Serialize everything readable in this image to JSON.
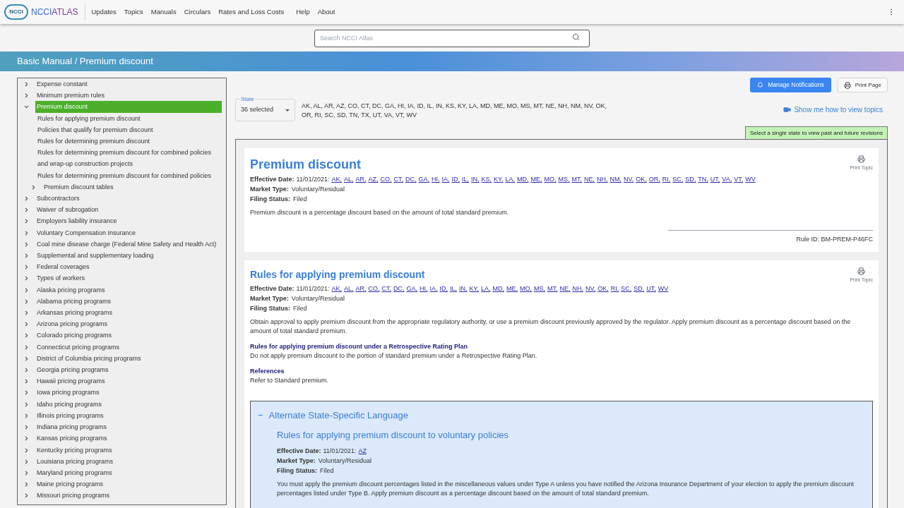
{
  "header": {
    "logo_badge": "NCCI",
    "logo_text_a": "NCCI",
    "logo_text_b": "ATLAS",
    "nav": [
      "Updates",
      "Topics",
      "Manuals",
      "Circulars",
      "Rates and Loss Costs",
      "Help",
      "About"
    ]
  },
  "search": {
    "placeholder": "Search NCCI Atlas"
  },
  "breadcrumb": "Basic Manual / Premium discount",
  "tree": [
    {
      "label": "Expense constant",
      "kind": "folder",
      "expanded": false,
      "selected": false
    },
    {
      "label": "Minimum premium rules",
      "kind": "folder",
      "expanded": false,
      "selected": false
    },
    {
      "label": "Premium discount",
      "kind": "folder",
      "expanded": true,
      "selected": true,
      "children": [
        {
          "label": "Rules for applying premium discount",
          "kind": "leaf",
          "selected": false
        },
        {
          "label": "Policies that qualify for premium discount",
          "kind": "leaf",
          "selected": false
        },
        {
          "label": "Rules for determining premium discount",
          "kind": "leaf",
          "selected": false
        },
        {
          "label": "Rules for determining premium discount for combined policies and wrap-up construction projects",
          "kind": "leaf",
          "selected": false
        },
        {
          "label": "Rules for determining premium discount for combined policies",
          "kind": "leaf",
          "selected": false
        },
        {
          "label": "Premium discount tables",
          "kind": "folder",
          "expanded": false,
          "selected": false
        }
      ]
    },
    {
      "label": "Subcontractors",
      "kind": "folder",
      "expanded": false,
      "selected": false
    },
    {
      "label": "Waiver of subrogation",
      "kind": "folder",
      "expanded": false,
      "selected": false
    },
    {
      "label": "Employers liability insurance",
      "kind": "folder",
      "expanded": false,
      "selected": false
    },
    {
      "label": "Voluntary Compensation Insurance",
      "kind": "folder",
      "expanded": false,
      "selected": false
    },
    {
      "label": "Coal mine disease charge (Federal Mine Safety and Health Act)",
      "kind": "folder",
      "expanded": false,
      "selected": false
    },
    {
      "label": "Supplemental and supplementary loading",
      "kind": "folder",
      "expanded": false,
      "selected": false
    },
    {
      "label": "Federal coverages",
      "kind": "folder",
      "expanded": false,
      "selected": false
    },
    {
      "label": "Types of workers",
      "kind": "folder",
      "expanded": false,
      "selected": false
    },
    {
      "label": "Alaska pricing programs",
      "kind": "folder",
      "expanded": false,
      "selected": false
    },
    {
      "label": "Alabama pricing programs",
      "kind": "folder",
      "expanded": false,
      "selected": false
    },
    {
      "label": "Arkansas pricing programs",
      "kind": "folder",
      "expanded": false,
      "selected": false
    },
    {
      "label": "Arizona pricing programs",
      "kind": "folder",
      "expanded": false,
      "selected": false
    },
    {
      "label": "Colorado pricing programs",
      "kind": "folder",
      "expanded": false,
      "selected": false
    },
    {
      "label": "Connecticut pricing programs",
      "kind": "folder",
      "expanded": false,
      "selected": false
    },
    {
      "label": "District of Columbia pricing programs",
      "kind": "folder",
      "expanded": false,
      "selected": false
    },
    {
      "label": "Georgia pricing programs",
      "kind": "folder",
      "expanded": false,
      "selected": false
    },
    {
      "label": "Hawaii pricing programs",
      "kind": "folder",
      "expanded": false,
      "selected": false
    },
    {
      "label": "Iowa pricing programs",
      "kind": "folder",
      "expanded": false,
      "selected": false
    },
    {
      "label": "Idaho pricing programs",
      "kind": "folder",
      "expanded": false,
      "selected": false
    },
    {
      "label": "Illinois pricing programs",
      "kind": "folder",
      "expanded": false,
      "selected": false
    },
    {
      "label": "Indiana pricing programs",
      "kind": "folder",
      "expanded": false,
      "selected": false
    },
    {
      "label": "Kansas pricing programs",
      "kind": "folder",
      "expanded": false,
      "selected": false
    },
    {
      "label": "Kentucky pricing programs",
      "kind": "folder",
      "expanded": false,
      "selected": false
    },
    {
      "label": "Louisiana pricing programs",
      "kind": "folder",
      "expanded": false,
      "selected": false
    },
    {
      "label": "Maryland pricing programs",
      "kind": "folder",
      "expanded": false,
      "selected": false
    },
    {
      "label": "Maine pricing programs",
      "kind": "folder",
      "expanded": false,
      "selected": false
    },
    {
      "label": "Missouri pricing programs",
      "kind": "folder",
      "expanded": false,
      "selected": false
    }
  ],
  "state_filter": {
    "label": "State",
    "value": "36 selected",
    "states_line_1": "AK, AL, AR, AZ, CO, CT, DC, GA, HI, IA, ID, IL, IN, KS, KY, LA, MD, ME, MO, MS, MT, NE, NH, NM, NV, OK,",
    "states_line_2": "OR, RI, SC, SD, TN, TX, UT, VA, VT, WV"
  },
  "actions": {
    "notify": "Manage Notifications",
    "print": "Print Page",
    "howto": "Show me how to view topics",
    "note": "Select a single state to view past and future revisions"
  },
  "topics": [
    {
      "title": "Premium discount",
      "print": "Print Topic",
      "effective_label": "Effective Date:",
      "effective_date": "11/01/2021:",
      "states": [
        "AK,",
        "AL,",
        "AR,",
        "AZ,",
        "CO,",
        "CT,",
        "DC,",
        "GA,",
        "HI,",
        "IA,",
        "ID,",
        "IL,",
        "IN,",
        "KS,",
        "KY,",
        "LA,",
        "MD,",
        "ME,",
        "MO,",
        "MS,",
        "MT,",
        "NE,",
        "NH,",
        "NM,",
        "NV,",
        "OK,",
        "OR,",
        "RI,",
        "SC,",
        "SD,",
        "TN,",
        "UT,",
        "VA,",
        "VT,",
        "WV"
      ],
      "market_label": "Market Type:",
      "market": "Voluntary/Residual",
      "filing_label": "Filing Status:",
      "filing": "Filed",
      "body": "Premium discount is a percentage discount based on the amount of total standard premium.",
      "rule_id": "Rule ID: BM-PREM-P46FC"
    },
    {
      "title": "Rules for applying premium discount",
      "print": "Print Topic",
      "effective_label": "Effective Date:",
      "effective_date": "11/01/2021:",
      "states": [
        "AK,",
        "AL,",
        "AR,",
        "CO,",
        "CT,",
        "DC,",
        "GA,",
        "HI,",
        "IA,",
        "ID,",
        "IL,",
        "IN,",
        "KY,",
        "LA,",
        "MD,",
        "ME,",
        "MO,",
        "MS,",
        "MT,",
        "NE,",
        "NH,",
        "NV,",
        "OK,",
        "RI,",
        "SC,",
        "SD,",
        "UT,",
        "WV"
      ],
      "market_label": "Market Type:",
      "market": "Voluntary/Residual",
      "filing_label": "Filing Status:",
      "filing": "Filed",
      "body": "Obtain approval to apply premium discount from the appropriate regulatory authority, or use a premium discount previously approved by the regulator. Apply premium discount as a percentage discount based on the amount of total standard premium.",
      "sections": [
        {
          "heading": "Rules for applying premium discount under a Retrospective Rating Plan",
          "text": "Do not apply premium discount to the portion of standard premium under a Retrospective Rating Plan."
        },
        {
          "heading": "References",
          "text": "Refer to Standard premium."
        }
      ],
      "alternate": {
        "toggle": "−",
        "heading": "Alternate State-Specific Language",
        "title": "Rules for applying premium discount to voluntary policies",
        "effective_label": "Effective Date:",
        "effective_date": "11/01/2021:",
        "states": [
          "AZ"
        ],
        "market_label": "Market Type:",
        "market": "Voluntary/Residual",
        "filing_label": "Filing Status:",
        "filing": "Filed",
        "body": "You must apply the premium discount percentages listed in the miscellaneous values under Type A unless you have notified the Arizona Insurance Department of your election to apply the premium discount percentages listed under Type B. Apply premium discount as a percentage discount based on the amount of total standard premium."
      }
    }
  ]
}
